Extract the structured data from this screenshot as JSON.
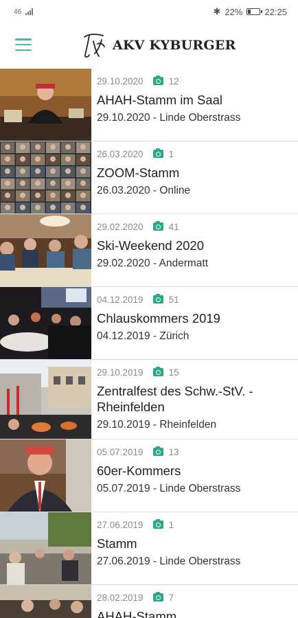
{
  "status": {
    "carrier": "46",
    "battery": "22%",
    "battery_level": 0.22,
    "time": "22:25"
  },
  "header": {
    "app_title": "AKV KYBURGER"
  },
  "albums": [
    {
      "date": "29.10.2020",
      "photo_count": "12",
      "title": "AHAH-Stamm im Saal",
      "subtitle": "29.10.2020 - Linde Oberstrass"
    },
    {
      "date": "26.03.2020",
      "photo_count": "1",
      "title": "ZOOM-Stamm",
      "subtitle": "26.03.2020 - Online"
    },
    {
      "date": "29.02.2020",
      "photo_count": "41",
      "title": "Ski-Weekend 2020",
      "subtitle": "29.02.2020 - Andermatt"
    },
    {
      "date": "04.12.2019",
      "photo_count": "51",
      "title": "Chlauskommers 2019",
      "subtitle": "04.12.2019 - Zürich"
    },
    {
      "date": "29.10.2019",
      "photo_count": "15",
      "title": "Zentralfest des Schw.-StV. - Rheinfelden",
      "subtitle": "29.10.2019 - Rheinfelden"
    },
    {
      "date": "05.07.2019",
      "photo_count": "13",
      "title": "60er-Kommers",
      "subtitle": "05.07.2019 - Linde Oberstrass"
    },
    {
      "date": "27.06.2019",
      "photo_count": "1",
      "title": "Stamm",
      "subtitle": "27.06.2019 - Linde Oberstrass"
    },
    {
      "date": "28.02.2019",
      "photo_count": "7",
      "title": "AHAH-Stamm",
      "subtitle": ""
    }
  ],
  "colors": {
    "accent": "#2aa88a",
    "menu": "#4db6a2",
    "divider": "#dcdcdc"
  }
}
